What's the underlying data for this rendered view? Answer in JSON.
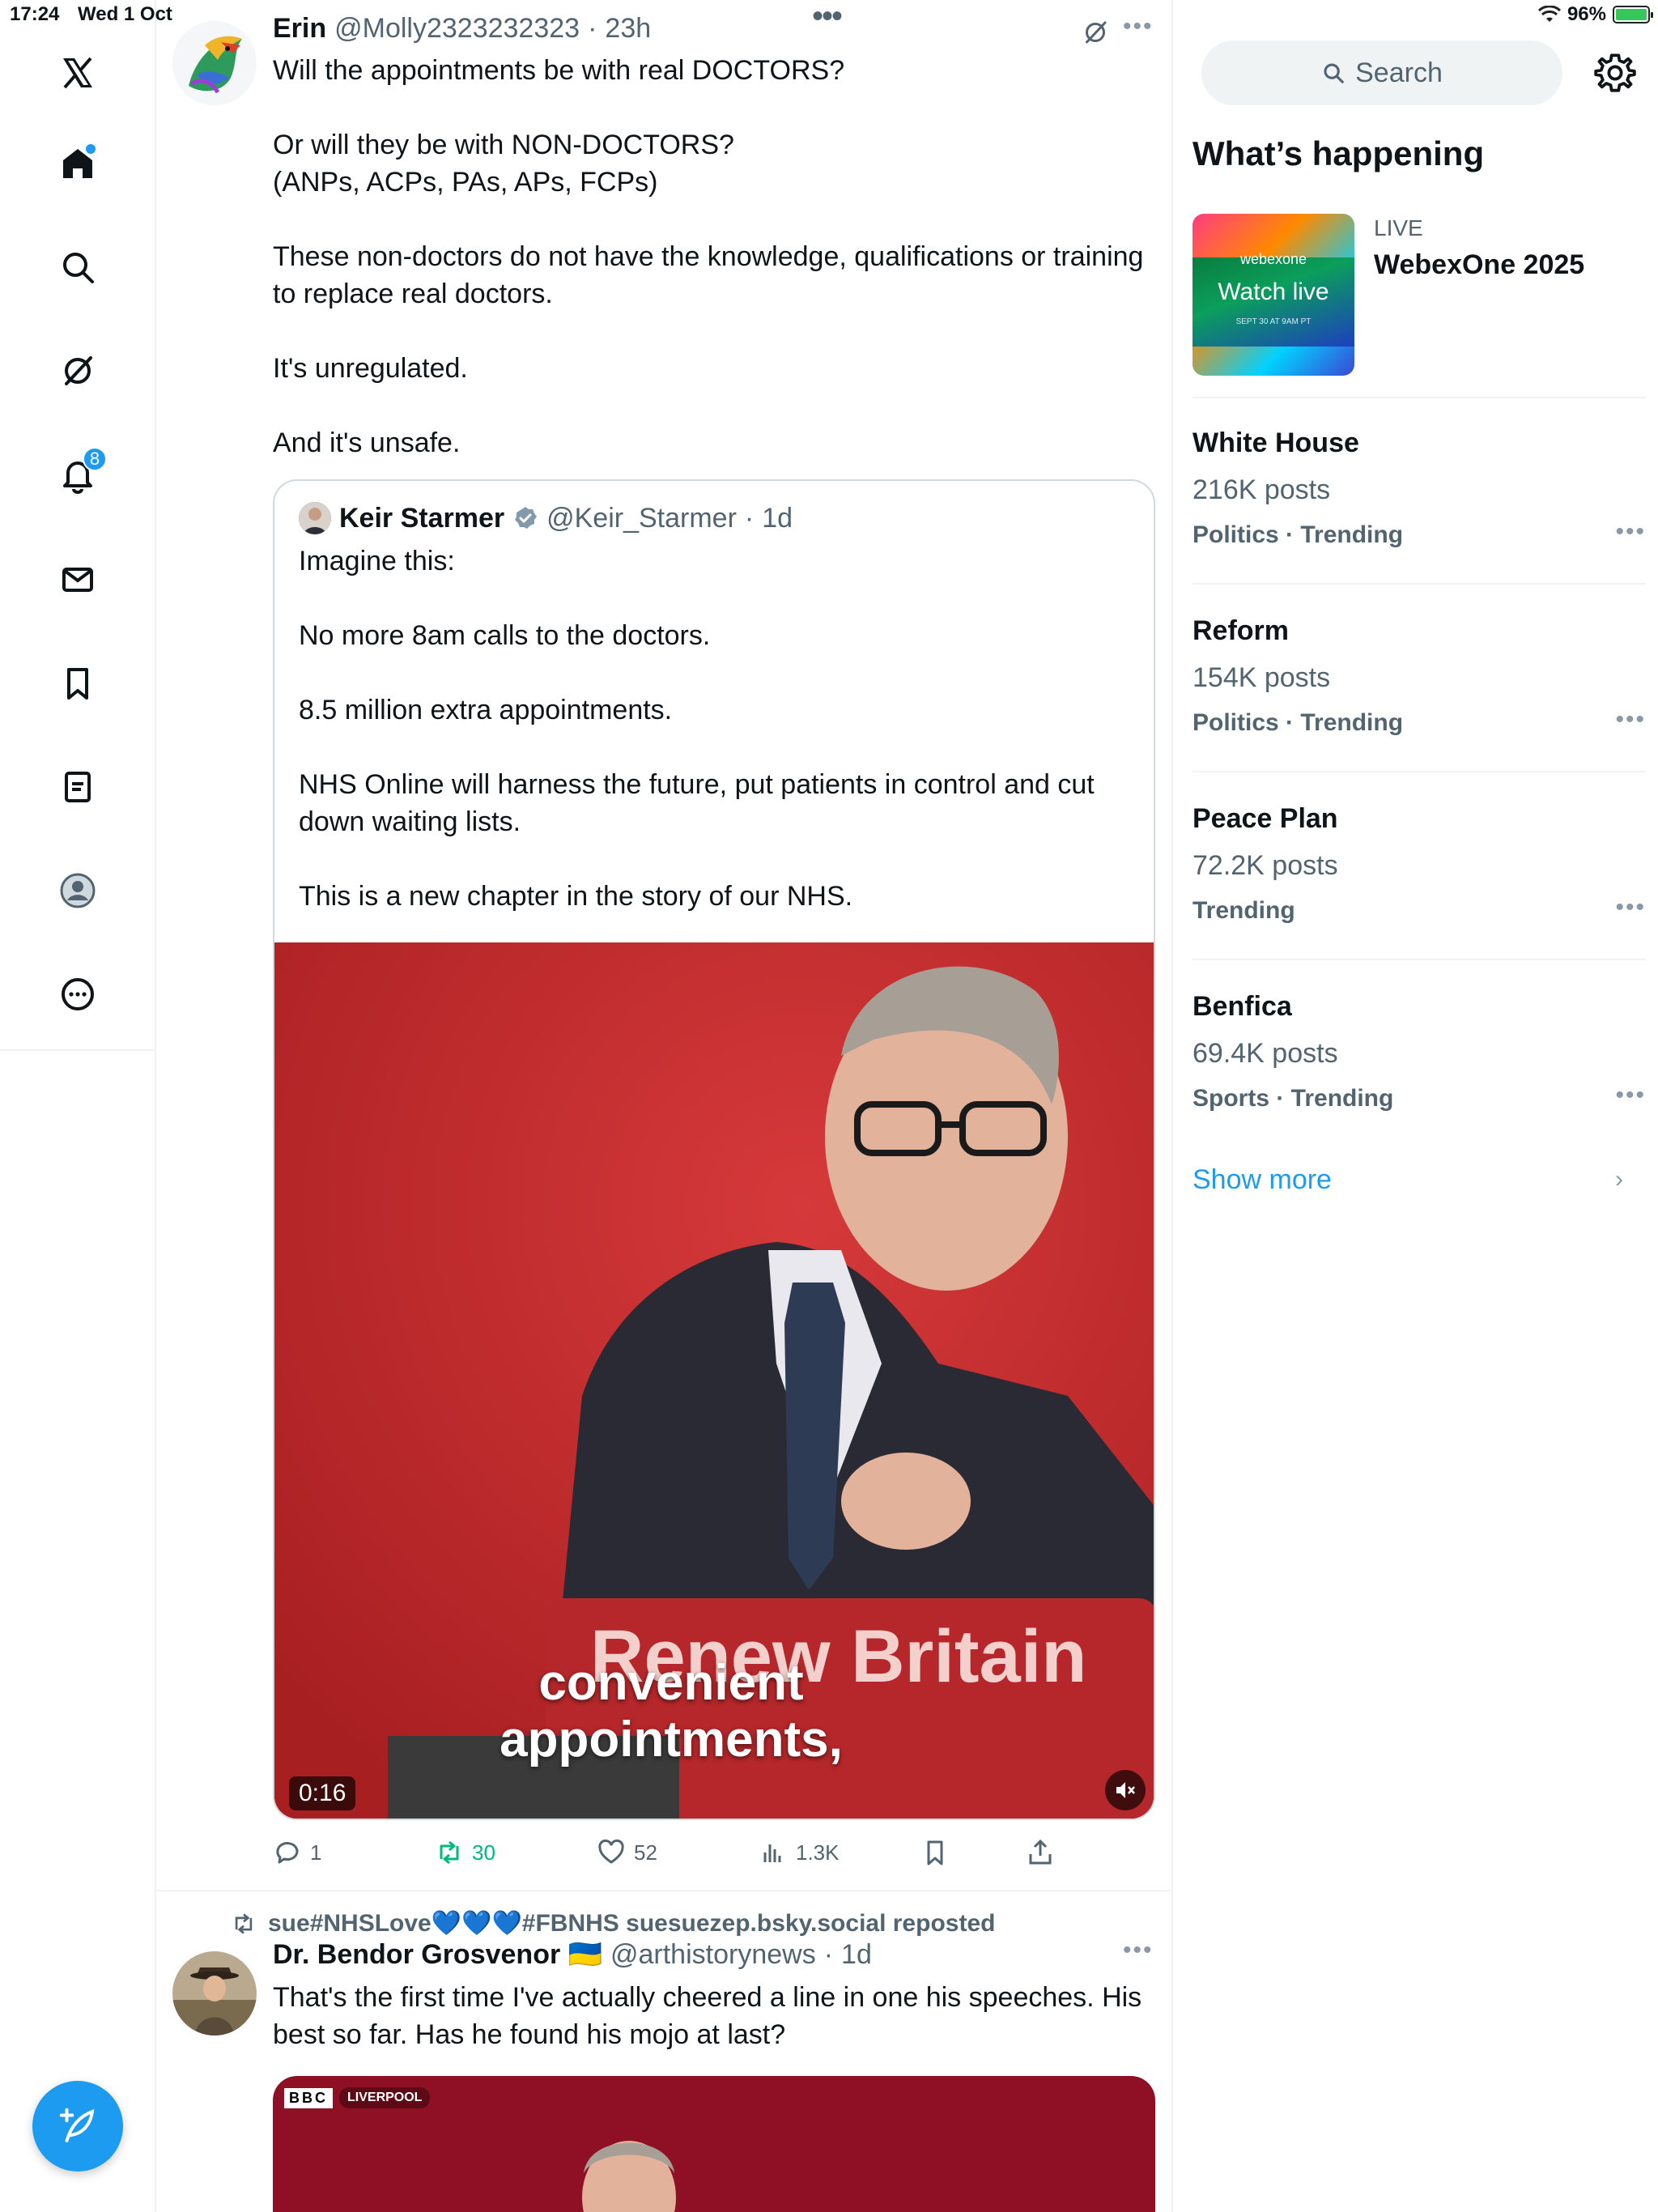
{
  "status_bar": {
    "time": "17:24",
    "date": "Wed 1 Oct",
    "battery": "96%"
  },
  "nav": {
    "notifications_count": "8"
  },
  "posts": [
    {
      "name": "Erin",
      "handle": "@Molly2323232323",
      "time": "23h",
      "text": [
        "Will the appointments be with real DOCTORS?",
        "",
        "Or will they be with NON-DOCTORS?",
        "(ANPs, ACPs, PAs, APs, FCPs)",
        "",
        "These non-doctors do not have the knowledge, qualifications or training to replace real doctors.",
        "",
        "It's unregulated.",
        "",
        "And it's unsafe."
      ],
      "quote": {
        "name": "Keir Starmer",
        "handle": "@Keir_Starmer",
        "time": "1d",
        "text": [
          "Imagine this:",
          "",
          "No more 8am calls to the doctors.",
          "",
          "8.5 million extra appointments.",
          "",
          "NHS Online will harness the future, put patients in control and cut down waiting lists.",
          "",
          "This is a new chapter in the story of our NHS."
        ],
        "video": {
          "duration": "0:16",
          "podium_text": "Renew Britain",
          "caption_line1": "convenient",
          "caption_line2": "appointments,"
        }
      },
      "stats": {
        "replies": "1",
        "reposts": "30",
        "likes": "52",
        "views": "1.3K"
      }
    },
    {
      "repost_by": "sue#NHSLove💙💙💙#FBNHS suesuezep.bsky.social reposted",
      "name": "Dr. Bendor Grosvenor 🇺🇦",
      "handle": "@arthistorynews",
      "time": "1d",
      "text": [
        "That's the first time I've actually cheered a line in one his speeches. His best so far. Has he found his mojo at last?"
      ],
      "media_tag": "BBC",
      "media_tag2": "LIVERPOOL"
    }
  ],
  "sidebar": {
    "search_placeholder": "Search",
    "title": "What’s happening",
    "promo": {
      "label": "LIVE",
      "title": "WebexOne 2025",
      "img_brand": "webexone",
      "img_cta": "Watch live",
      "img_date": "SEPT 30 AT 9AM PT"
    },
    "trends": [
      {
        "name": "White House",
        "count": "216K posts",
        "category": "Politics · Trending"
      },
      {
        "name": "Reform",
        "count": "154K posts",
        "category": "Politics · Trending"
      },
      {
        "name": "Peace Plan",
        "count": "72.2K posts",
        "category": "Trending"
      },
      {
        "name": "Benfica",
        "count": "69.4K posts",
        "category": "Sports · Trending"
      }
    ],
    "show_more": "Show more"
  },
  "colors": {
    "accent": "#1d9bf0",
    "retweet": "#00ba7c",
    "muted": "#536471",
    "video_bg": "#c2292b"
  }
}
